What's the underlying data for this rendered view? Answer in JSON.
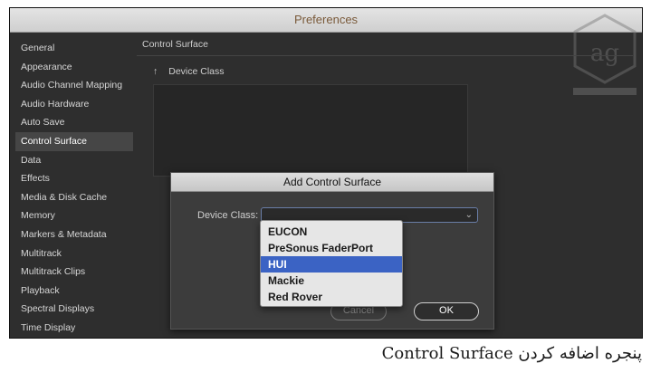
{
  "window": {
    "title": "Preferences"
  },
  "sidebar": {
    "items": [
      {
        "label": "General"
      },
      {
        "label": "Appearance"
      },
      {
        "label": "Audio Channel Mapping"
      },
      {
        "label": "Audio Hardware"
      },
      {
        "label": "Auto Save"
      },
      {
        "label": "Control Surface",
        "selected": true
      },
      {
        "label": "Data"
      },
      {
        "label": "Effects"
      },
      {
        "label": "Media & Disk Cache"
      },
      {
        "label": "Memory"
      },
      {
        "label": "Markers & Metadata"
      },
      {
        "label": "Multitrack"
      },
      {
        "label": "Multitrack Clips"
      },
      {
        "label": "Playback"
      },
      {
        "label": "Spectral Displays"
      },
      {
        "label": "Time Display"
      }
    ]
  },
  "main": {
    "section_title": "Control Surface",
    "column_arrow": "↑",
    "column_header": "Device Class"
  },
  "dialog": {
    "title": "Add Control Surface",
    "device_class_label": "Device Class:",
    "device_class_value": "",
    "cancel_label": "Cancel",
    "ok_label": "OK"
  },
  "dropdown": {
    "options": [
      {
        "label": "EUCON"
      },
      {
        "label": "PreSonus FaderPort"
      },
      {
        "label": "HUI",
        "highlighted": true
      },
      {
        "label": "Mackie"
      },
      {
        "label": "Red Rover"
      }
    ]
  },
  "caption": {
    "text": "پنجره اضافه کردن Control Surface"
  },
  "colors": {
    "selection_blue": "#3b63c4",
    "panel_dark": "#2e2e2e"
  }
}
